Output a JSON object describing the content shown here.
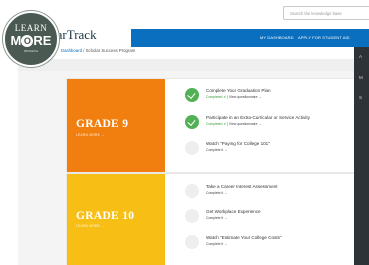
{
  "search": {
    "placeholder": "Search the knowledge base"
  },
  "logo": {
    "line1": "LEARN",
    "line2_prefix": "M",
    "line2_o": "O",
    "line2_suffix": "RE",
    "subline": "INDIANA"
  },
  "header": {
    "app_title": "ScholarTrack"
  },
  "nav": {
    "items": [
      "MY DASHBOARD",
      "APPLY FOR STUDENT AID"
    ]
  },
  "side_letters": [
    "A",
    "M",
    "S"
  ],
  "breadcrumb": {
    "home": "Dashboard",
    "separator": "/",
    "current": "Scholar Success Program"
  },
  "grades": [
    {
      "title": "GRADE 9",
      "learn_more": "LEARN MORE →",
      "color": "#f07f0f",
      "tasks": [
        {
          "title": "Complete Your Graduation Plan",
          "status": "Completed ✔",
          "separator": "|",
          "link": "View questionnaire →",
          "done": true
        },
        {
          "title": "Participate in an Extra-Curricular or Service Activity",
          "status": "Completed ✔",
          "separator": "|",
          "link": "View questionnaire →",
          "done": true
        },
        {
          "title": "Watch \"Paying for College 101\"",
          "status": "Complete it →",
          "separator": "",
          "link": "",
          "done": false
        }
      ]
    },
    {
      "title": "GRADE 10",
      "learn_more": "LEARN MORE →",
      "color": "#f7bf16",
      "tasks": [
        {
          "title": "Take a Career Interest Assessment",
          "status": "Complete it →",
          "done": false
        },
        {
          "title": "Get Workplace Experience",
          "status": "Complete it →",
          "done": false
        },
        {
          "title": "Watch \"Estimate Your College Costs\"",
          "status": "Complete it →",
          "done": false
        }
      ]
    }
  ],
  "colors": {
    "nav_blue": "#0a6fbf",
    "done_green": "#52b155",
    "dark_edge": "#2e3337"
  }
}
